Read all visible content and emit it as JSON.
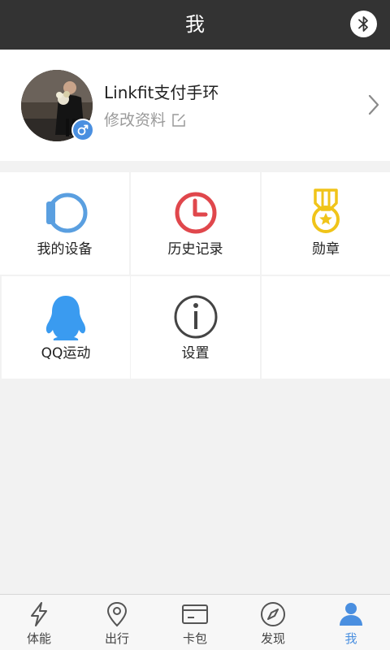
{
  "header": {
    "title": "我",
    "bluetooth_icon": "bluetooth-icon"
  },
  "profile": {
    "name": "Linkfit支付手环",
    "edit_label": "修改资料",
    "gender_icon": "male-icon",
    "accent_color": "#4a8fe0"
  },
  "menu": {
    "items": [
      {
        "label": "我的设备",
        "icon": "watch-icon",
        "color": "#5a9fe0"
      },
      {
        "label": "历史记录",
        "icon": "clock-icon",
        "color": "#e0474c"
      },
      {
        "label": "勋章",
        "icon": "medal-icon",
        "color": "#f0c419"
      },
      {
        "label": "QQ运动",
        "icon": "qq-penguin-icon",
        "color": "#3a9bf0"
      },
      {
        "label": "设置",
        "icon": "info-icon",
        "color": "#444444"
      }
    ]
  },
  "tabbar": {
    "active_index": 4,
    "items": [
      {
        "label": "体能",
        "icon": "lightning-icon"
      },
      {
        "label": "出行",
        "icon": "location-pin-icon"
      },
      {
        "label": "卡包",
        "icon": "card-icon"
      },
      {
        "label": "发现",
        "icon": "compass-icon"
      },
      {
        "label": "我",
        "icon": "person-icon"
      }
    ]
  }
}
